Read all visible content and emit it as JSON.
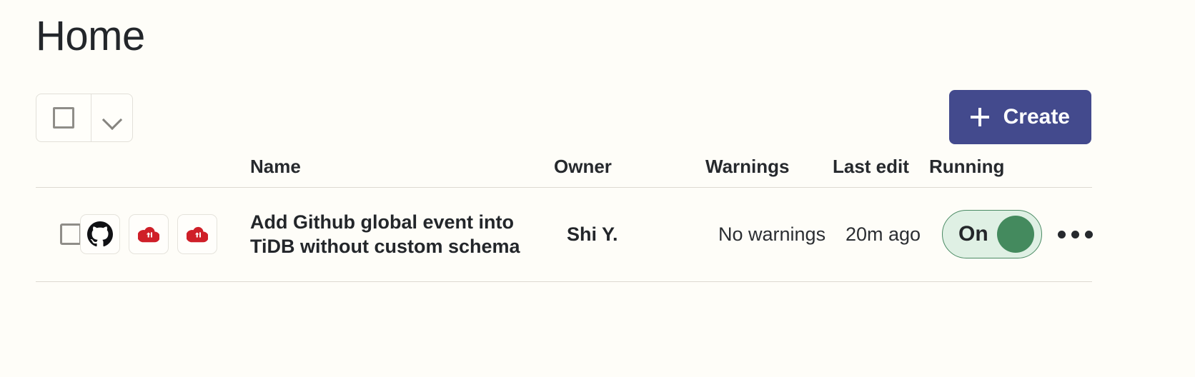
{
  "page": {
    "title": "Home",
    "background_color": "#fefdf8"
  },
  "toolbar": {
    "view_button": {
      "icon": "square-icon",
      "label": ""
    },
    "view_dropdown": {
      "icon": "chevron-down-icon",
      "label": ""
    },
    "create_button": {
      "label": "Create",
      "icon": "plus-icon",
      "color": "#434a8d",
      "text_color": "#ffffff"
    }
  },
  "table": {
    "columns": [
      {
        "key": "select",
        "label": ""
      },
      {
        "key": "icons",
        "label": ""
      },
      {
        "key": "name",
        "label": "Name"
      },
      {
        "key": "owner",
        "label": "Owner"
      },
      {
        "key": "warnings",
        "label": "Warnings"
      },
      {
        "key": "last_edit",
        "label": "Last edit"
      },
      {
        "key": "running",
        "label": "Running"
      },
      {
        "key": "actions",
        "label": ""
      }
    ],
    "rows": [
      {
        "selected": false,
        "icons": [
          "github-icon",
          "tidb-cloud-icon",
          "tidb-cloud-icon"
        ],
        "name": "Add Github global event into TiDB without custom schema",
        "owner": "Shi Y.",
        "warnings": "No warnings",
        "last_edit": "20m ago",
        "running": {
          "label": "On",
          "state": "on",
          "track_color": "#dff0e4",
          "knob_color": "#448a5e",
          "border_color": "#4a8a63"
        },
        "actions_icon": "kebab-menu-icon"
      }
    ]
  }
}
